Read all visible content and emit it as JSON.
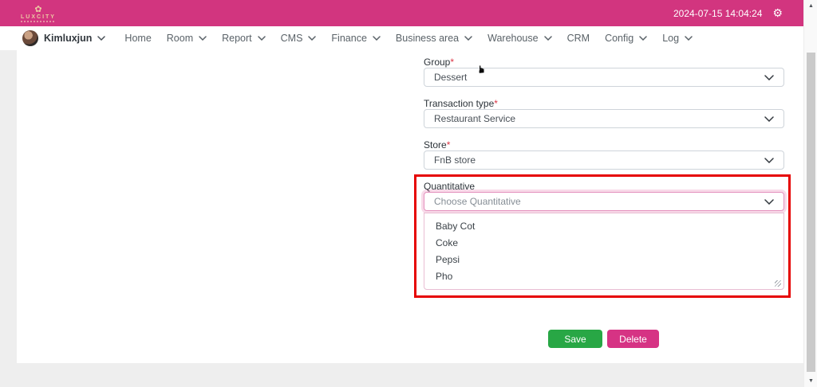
{
  "header": {
    "brand": "LUXCITY",
    "flower_icon": "✿",
    "datetime": "2024-07-15 14:04:24",
    "gear_icon": "⚙"
  },
  "navbar": {
    "user": {
      "name": "Kimluxjun"
    },
    "items": [
      {
        "label": "Home"
      },
      {
        "label": "Room"
      },
      {
        "label": "Report"
      },
      {
        "label": "CMS"
      },
      {
        "label": "Finance"
      },
      {
        "label": "Business area"
      },
      {
        "label": "Warehouse"
      },
      {
        "label": "CRM"
      },
      {
        "label": "Config"
      },
      {
        "label": "Log"
      }
    ]
  },
  "form": {
    "required_mark": "*",
    "fields": [
      {
        "label": "Group",
        "value": "Dessert"
      },
      {
        "label": "Transaction type",
        "value": "Restaurant Service"
      },
      {
        "label": "Store",
        "value": "FnB store"
      }
    ],
    "quantitative": {
      "label": "Quantitative",
      "placeholder": "Choose Quantitative",
      "options": [
        "Baby Cot",
        "Coke",
        "Pepsi",
        "Pho"
      ]
    },
    "buttons": {
      "save": "Save",
      "delete": "Delete"
    }
  },
  "cursor_icon": "☛",
  "colors": {
    "header_pink": "#d2357f",
    "save_green": "#28a745",
    "delete_pink": "#d63384",
    "annotation_red": "#e60202",
    "focus_border_pink": "#e490bd"
  }
}
